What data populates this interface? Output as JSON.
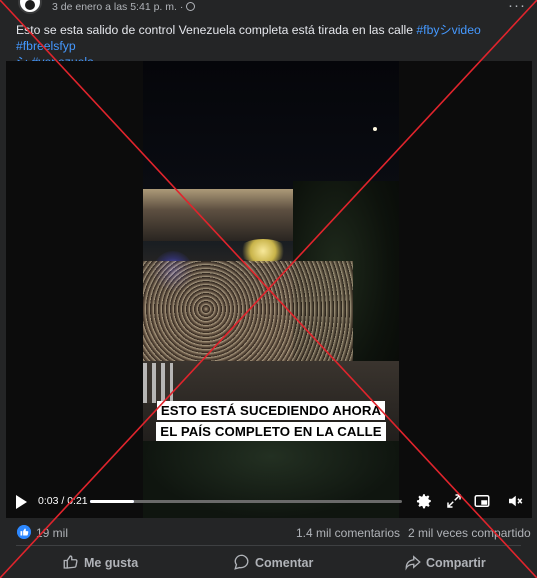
{
  "post": {
    "timestamp": "3 de enero a las 5:41 p. m. ·",
    "caption_text": "Esto se esta salido de control Venezuela completa está tirada en las calle ",
    "hashtags": [
      "#fbyシvideo",
      "#fbreelsfyp",
      "シ #venezuela"
    ]
  },
  "video": {
    "subtitle_line1": "ESTO ESTÁ SUCEDIENDO AHORA",
    "subtitle_line2": "EL PAÍS COMPLETO EN LA CALLE",
    "time": "0:03 / 0:21",
    "progress": 0.14
  },
  "stats": {
    "likes": "19 mil",
    "comments": "1.4 mil comentarios",
    "shares": "2 mil veces compartido"
  },
  "actions": {
    "like": "Me gusta",
    "comment": "Comentar",
    "share": "Compartir"
  },
  "colors": {
    "background": "#242526",
    "hashtag": "#4599ff",
    "x_mark": "#e0242c",
    "like_badge": "#2d88ff"
  }
}
